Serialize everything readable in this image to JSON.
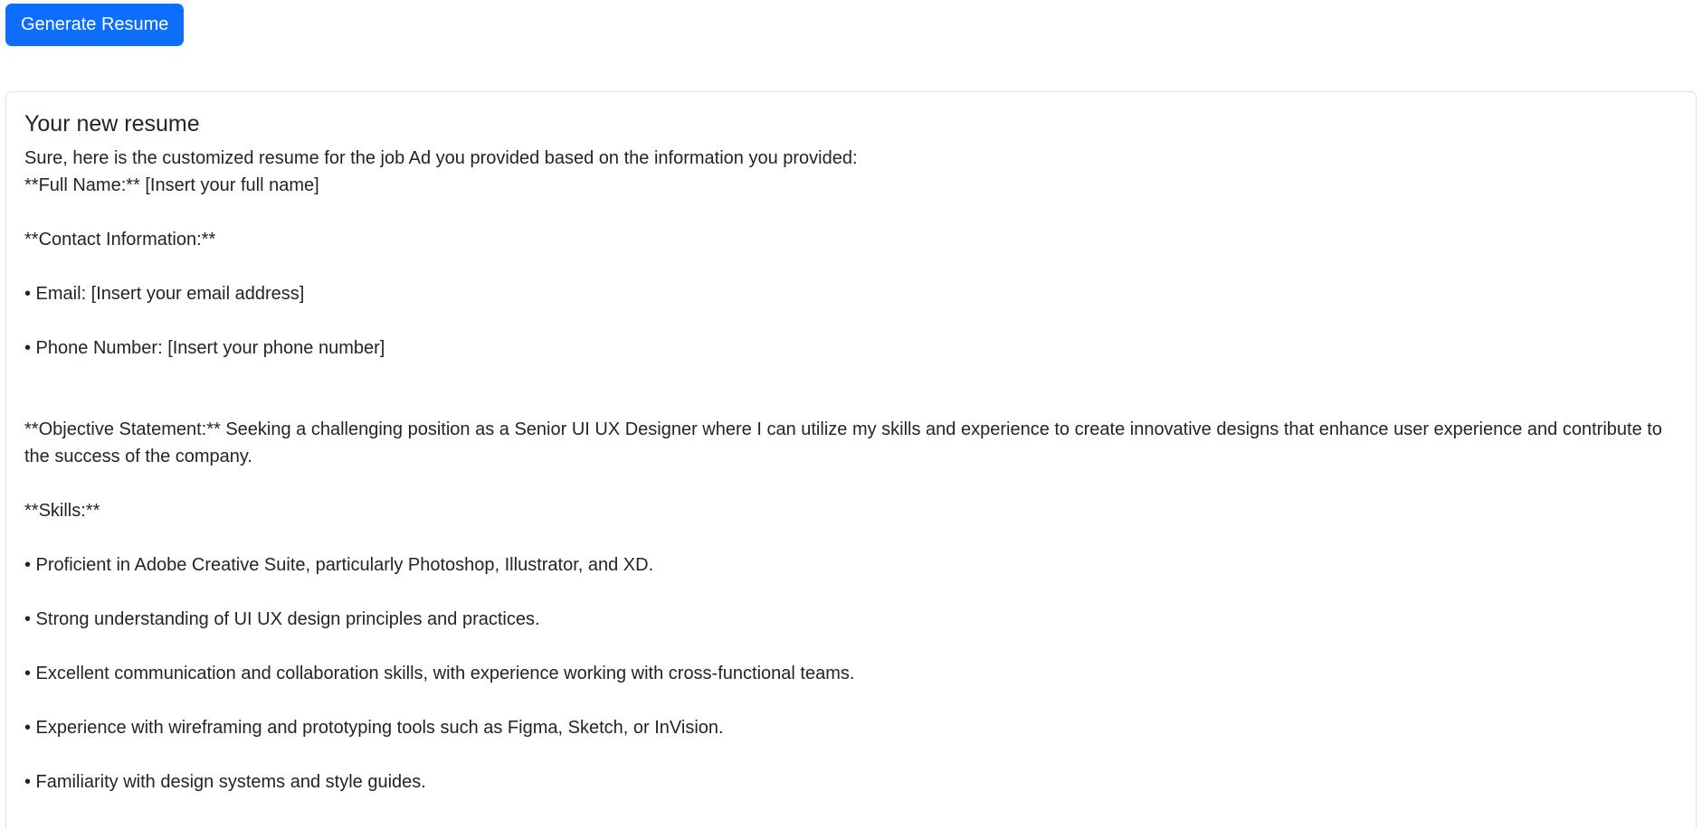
{
  "actions": {
    "generate_label": "Generate Resume"
  },
  "result": {
    "title": "Your new resume",
    "intro": "Sure, here is the customized resume for the job Ad you provided based on the information you provided:",
    "full_name": "**Full Name:** [Insert your full name]",
    "contact_heading": "**Contact Information:**",
    "email": "• Email: [Insert your email address]",
    "phone": "• Phone Number: [Insert your phone number]",
    "objective": "**Objective Statement:** Seeking a challenging position as a Senior UI UX Designer where I can utilize my skills and experience to create innovative designs that enhance user experience and contribute to the success of the company.",
    "skills_heading": "**Skills:**",
    "skills": [
      "• Proficient in Adobe Creative Suite, particularly Photoshop, Illustrator, and XD.",
      "• Strong understanding of UI UX design principles and practices.",
      "• Excellent communication and collaboration skills, with experience working with cross-functional teams.",
      "• Experience with wireframing and prototyping tools such as Figma, Sketch, or InVision.",
      "• Familiarity with design systems and style guides."
    ]
  }
}
